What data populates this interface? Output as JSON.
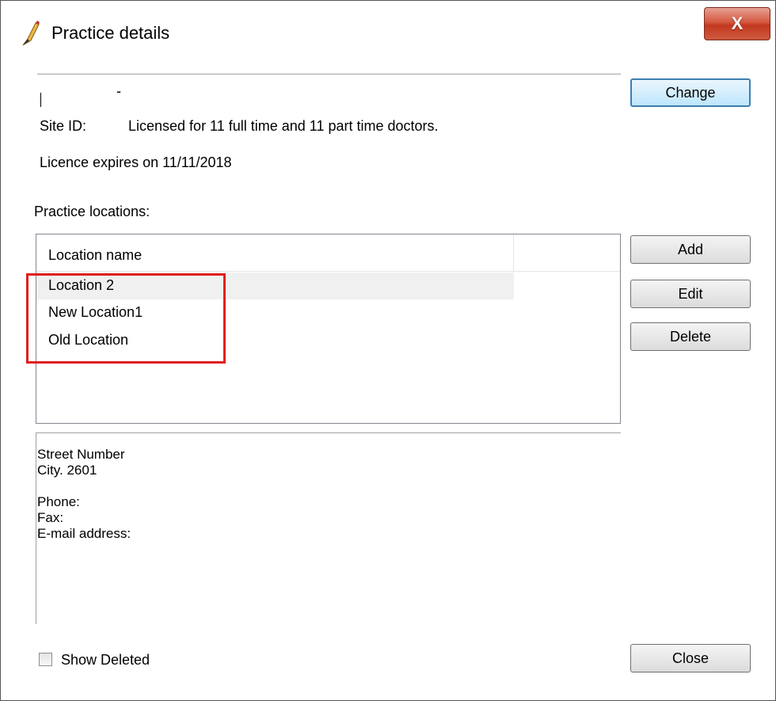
{
  "window": {
    "title": "Practice details",
    "close_label": "X"
  },
  "header": {
    "dash": "-",
    "site_id_label": "Site ID:",
    "license_text": "Licensed for 11 full time and 11 part time doctors.",
    "licence_expiry": "Licence expires on 11/11/2018"
  },
  "locations": {
    "section_label": "Practice locations:",
    "column_header": "Location name",
    "items": [
      {
        "name": "Location 2",
        "selected": true
      },
      {
        "name": "New Location1",
        "selected": false
      },
      {
        "name": "Old Location",
        "selected": false
      }
    ]
  },
  "address_lines": [
    "Street Number",
    "City. 2601",
    "",
    "Phone:",
    "Fax:",
    "E-mail address:"
  ],
  "buttons": {
    "change": "Change",
    "add": "Add",
    "edit": "Edit",
    "delete": "Delete",
    "close": "Close"
  },
  "show_deleted": {
    "label": "Show Deleted",
    "checked": false
  },
  "icons": {
    "app": "pen-icon",
    "close": "close-icon",
    "checkbox": "checkbox-icon"
  },
  "colors": {
    "highlight_box": "#e02020",
    "close_button": "#c2381f",
    "default_button_border": "#3c7fb1"
  }
}
